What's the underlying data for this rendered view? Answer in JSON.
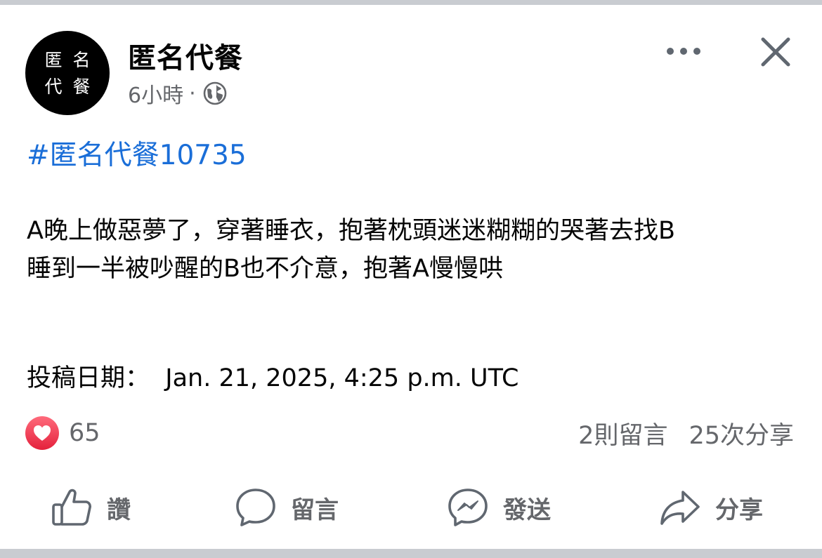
{
  "post": {
    "page_name": "匿名代餐",
    "avatar_chars": [
      "匿",
      "名",
      "代",
      "餐"
    ],
    "time": "6小時",
    "separator": "·",
    "hashtag": "#匿名代餐10735",
    "body_lines": [
      "A晚上做惡夢了，穿著睡衣，抱著枕頭迷迷糊糊的哭著去找B",
      "睡到一半被吵醒的B也不介意，抱著A慢慢哄"
    ],
    "date_label": "投稿日期：",
    "date_value": "Jan. 21, 2025, 4:25 p.m. UTC"
  },
  "stats": {
    "reaction_count": "65",
    "comments": "2則留言",
    "shares": "25次分享"
  },
  "actions": {
    "like": "讚",
    "comment": "留言",
    "send": "發送",
    "share": "分享"
  },
  "icons": {
    "avatar": "page-avatar",
    "audience": "globe-icon",
    "more": "more-options-icon",
    "close": "close-icon",
    "reaction": "heart-icon",
    "like": "thumbs-up-icon",
    "comment": "comment-bubble-icon",
    "send": "messenger-icon",
    "share": "share-arrow-icon"
  },
  "colors": {
    "hashtag": "#1a6ed8",
    "secondary_text": "#65676b",
    "heart": "#e4213c",
    "separator_bar": "#c9ccd1"
  }
}
